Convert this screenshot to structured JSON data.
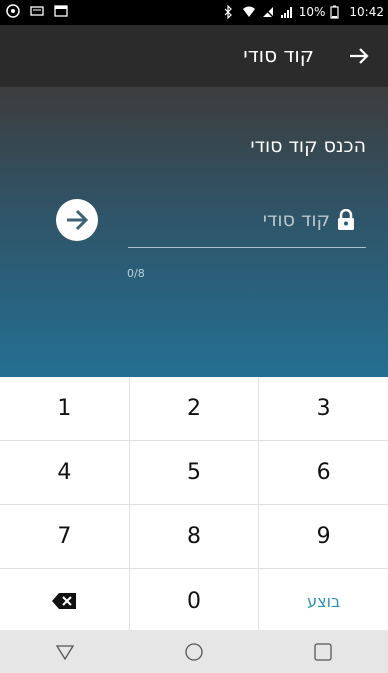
{
  "status_bar": {
    "battery": "10%",
    "time": "10:42"
  },
  "app_bar": {
    "title": "קוד סודי"
  },
  "form": {
    "prompt": "הכנס קוד סודי",
    "input_value": "",
    "input_placeholder": "קוד סודי",
    "counter": "0/8"
  },
  "keypad": {
    "keys": [
      [
        "1",
        "2",
        "3"
      ],
      [
        "4",
        "5",
        "6"
      ],
      [
        "7",
        "8",
        "9"
      ],
      [
        "",
        "0",
        "בוצע"
      ]
    ],
    "accent_color": "#2f8fb8"
  }
}
